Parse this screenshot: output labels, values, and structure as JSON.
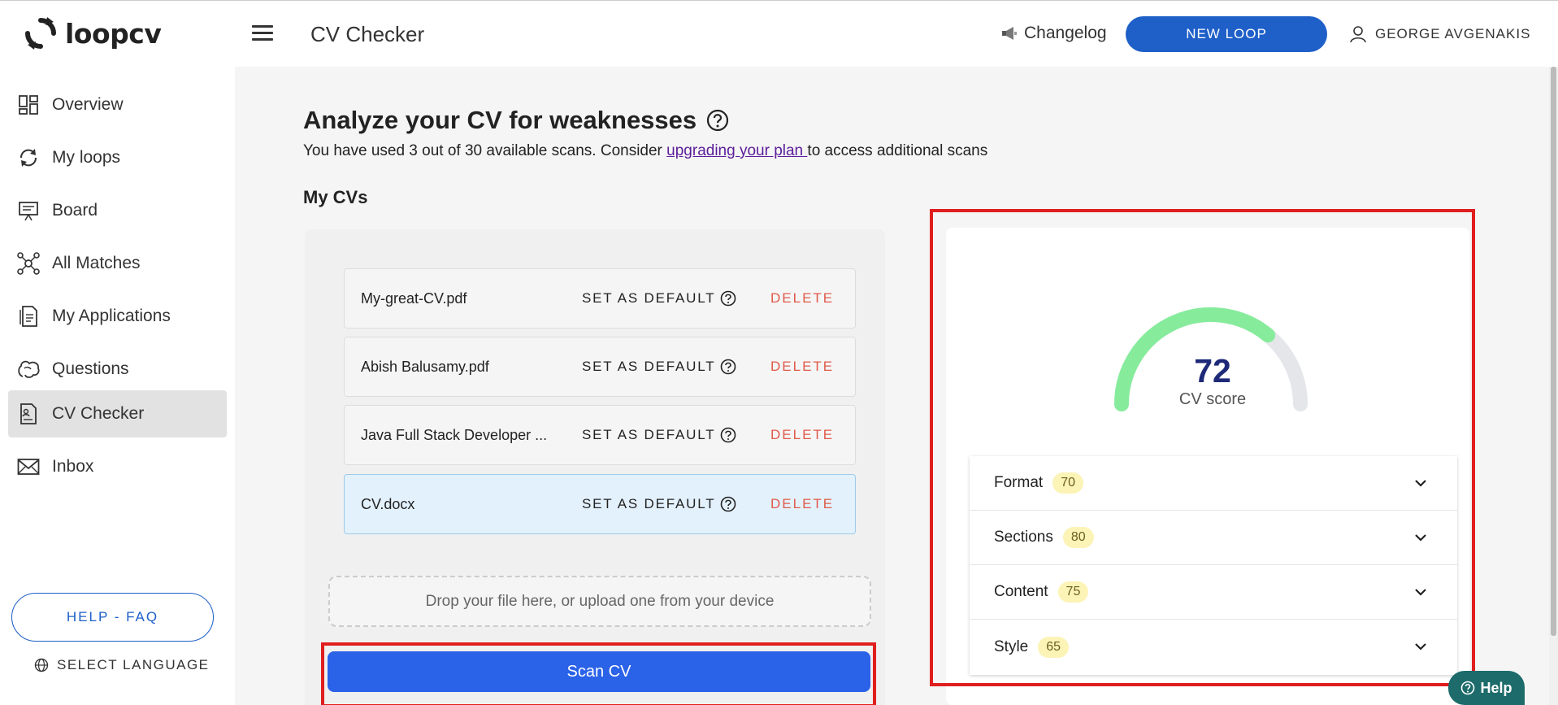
{
  "app": {
    "logo_text": "loopcv"
  },
  "header": {
    "page_title": "CV Checker",
    "changelog_label": "Changelog",
    "new_loop_label": "NEW LOOP",
    "user_name": "GEORGE AVGENAKIS"
  },
  "sidebar": {
    "items": [
      {
        "label": "Overview",
        "icon": "overview-icon"
      },
      {
        "label": "My loops",
        "icon": "loops-icon"
      },
      {
        "label": "Board",
        "icon": "board-icon"
      },
      {
        "label": "All Matches",
        "icon": "matches-icon"
      },
      {
        "label": "My Applications",
        "icon": "applications-icon"
      },
      {
        "label": "Questions",
        "icon": "questions-icon"
      },
      {
        "label": "CV Checker",
        "icon": "cv-checker-icon",
        "active": true
      },
      {
        "label": "Inbox",
        "icon": "inbox-icon"
      }
    ],
    "help_faq_label": "HELP - FAQ",
    "select_language_label": "SELECT LANGUAGE"
  },
  "main": {
    "title": "Analyze your CV for weaknesses",
    "subtitle_before": "You have used 3 out of 30 available scans. Consider ",
    "subtitle_link": "upgrading your plan ",
    "subtitle_after": "to access additional scans",
    "my_cvs_title": "My CVs",
    "cvs": [
      {
        "name": "My-great-CV.pdf",
        "set_default_label": "SET AS DEFAULT",
        "delete_label": "DELETE",
        "selected": false
      },
      {
        "name": "Abish Balusamy.pdf",
        "set_default_label": "SET AS DEFAULT",
        "delete_label": "DELETE",
        "selected": false
      },
      {
        "name": "Java Full Stack Developer ...",
        "set_default_label": "SET AS DEFAULT",
        "delete_label": "DELETE",
        "selected": false
      },
      {
        "name": "CV.docx",
        "set_default_label": "SET AS DEFAULT",
        "delete_label": "DELETE",
        "selected": true
      }
    ],
    "dropzone_text": "Drop your file here, or upload one from your device",
    "scan_button_label": "Scan CV"
  },
  "score": {
    "value": "72",
    "label": "CV score",
    "gauge_fraction": 0.72,
    "gauge_color": "#86ec9c",
    "metrics": [
      {
        "name": "Format",
        "score": "70"
      },
      {
        "name": "Sections",
        "score": "80"
      },
      {
        "name": "Content",
        "score": "75"
      },
      {
        "name": "Style",
        "score": "65"
      }
    ]
  },
  "help_chip_label": "Help",
  "colors": {
    "primary": "#1e5fc8",
    "scan_button": "#2a62e8",
    "delete": "#e05a4a",
    "highlight_outline": "#e01e1e"
  }
}
